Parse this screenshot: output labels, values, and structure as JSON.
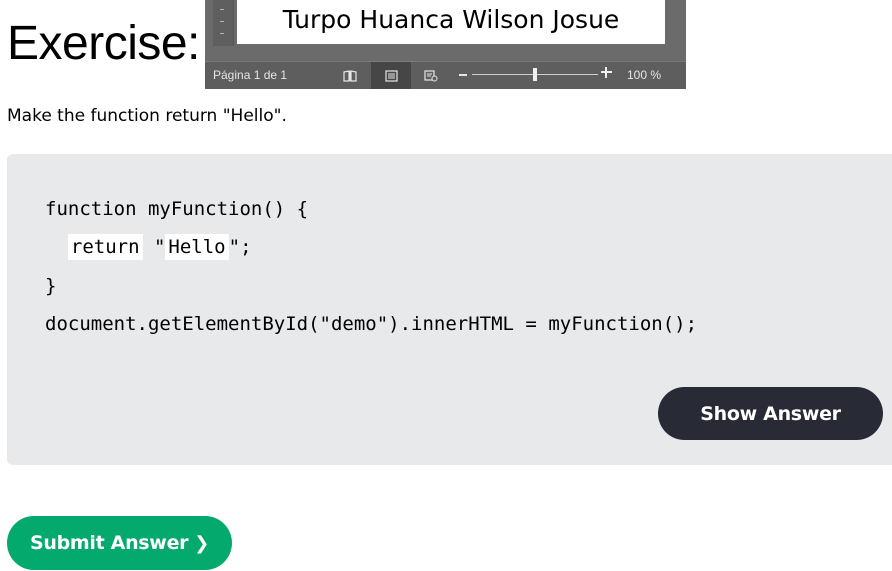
{
  "heading": "Exercise:",
  "document_window": {
    "page_text": "Turpo Huanca Wilson Josue",
    "status_page": "Página 1 de 1",
    "zoom_level": "100 %",
    "zoom_value": 0.5,
    "views": [
      {
        "name": "read-mode",
        "icon": "book-icon",
        "active": false
      },
      {
        "name": "print-layout",
        "icon": "page-icon",
        "active": true
      },
      {
        "name": "web-layout",
        "icon": "web-layout-icon",
        "active": false
      }
    ]
  },
  "instruction": "Make the function return \"Hello\".",
  "code": {
    "line1": "function myFunction() {",
    "line2_indent": "  ",
    "input1_value": "return",
    "line2_mid": " \"",
    "input2_value": "Hello",
    "line2_end": "\";",
    "line3": "}",
    "line4": "document.getElementById(\"demo\").innerHTML = myFunction();"
  },
  "show_answer_label": "Show Answer",
  "submit_label": "Submit Answer",
  "submit_chevron": "❯",
  "colors": {
    "submit_green": "#04aa6d",
    "show_answer_dark": "#282a35",
    "code_panel_bg": "#e7e9eb"
  }
}
